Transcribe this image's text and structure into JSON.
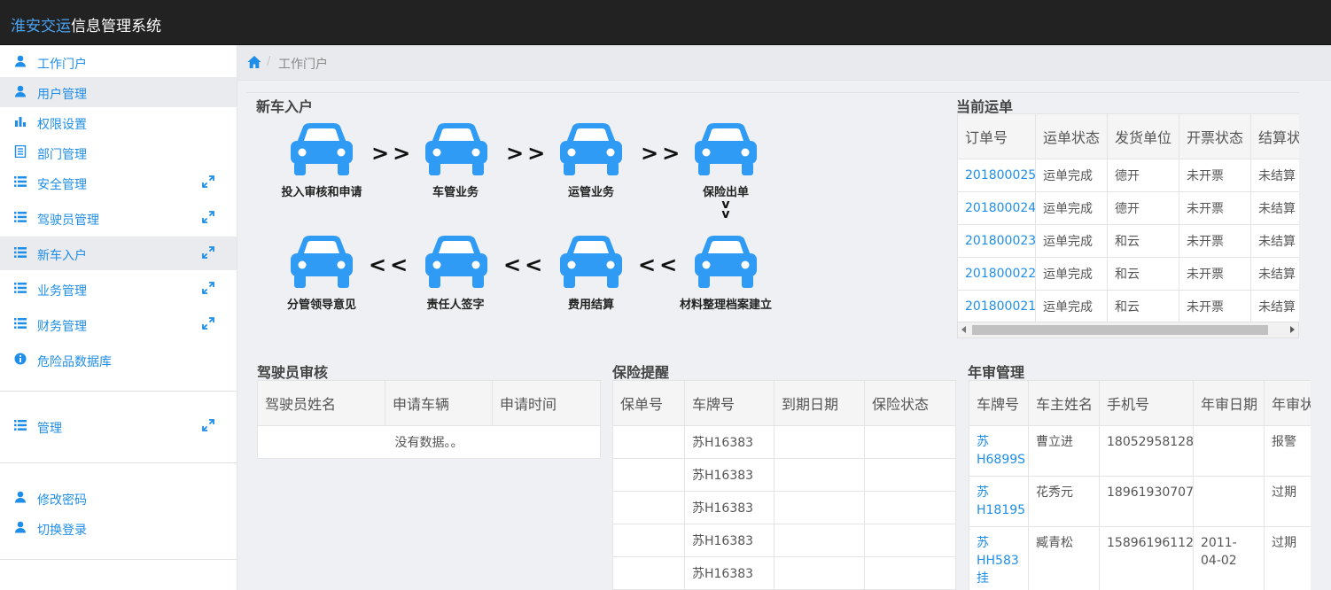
{
  "brand": {
    "highlight": "淮安交运",
    "rest": "信息管理系统"
  },
  "sidebar": {
    "items": [
      {
        "label": "工作门户",
        "icon": "user-icon"
      },
      {
        "label": "用户管理",
        "icon": "user-icon"
      },
      {
        "label": "权限设置",
        "icon": "bar-chart-icon"
      },
      {
        "label": "部门管理",
        "icon": "document-icon"
      },
      {
        "label": "安全管理",
        "icon": "list-icon",
        "expand_icon": "expand-icon"
      },
      {
        "label": "驾驶员管理",
        "icon": "list-icon",
        "expand_icon": "expand-icon"
      },
      {
        "label": "新车入户",
        "icon": "list-icon",
        "expand_icon": "expand-icon"
      },
      {
        "label": "业务管理",
        "icon": "list-icon",
        "expand_icon": "expand-icon"
      },
      {
        "label": "财务管理",
        "icon": "list-icon",
        "expand_icon": "expand-icon"
      },
      {
        "label": "危险品数据库",
        "icon": "info-icon"
      },
      {
        "label": "管理",
        "icon": "list-icon",
        "expand_icon": "expand-icon"
      },
      {
        "label": "修改密码",
        "icon": "user-icon"
      },
      {
        "label": "切换登录",
        "icon": "user-icon"
      }
    ]
  },
  "breadcrumb": {
    "home_icon": "home-icon",
    "separator": "/",
    "current": "工作门户"
  },
  "flow": {
    "title": "新车入户",
    "accent": "#2f9bf5",
    "steps": [
      "投入审核和申请",
      "车管业务",
      "运管业务",
      "保险出单",
      "材料整理档案建立",
      "费用结算",
      "责任人签字",
      "分管领导意见"
    ],
    "arrow_right": ">>",
    "arrow_left": "<<",
    "arrow_down": [
      "v",
      "v"
    ]
  },
  "orders": {
    "title": "当前运单",
    "columns": [
      "订单号",
      "运单状态",
      "发货单位",
      "开票状态",
      "结算状态"
    ],
    "rows": [
      [
        "201800025",
        "运单完成",
        "德开",
        "未开票",
        "未结算"
      ],
      [
        "201800024",
        "运单完成",
        "德开",
        "未开票",
        "未结算"
      ],
      [
        "201800023",
        "运单完成",
        "和云",
        "未开票",
        "未结算"
      ],
      [
        "201800022",
        "运单完成",
        "和云",
        "未开票",
        "未结算"
      ],
      [
        "201800021",
        "运单完成",
        "和云",
        "未开票",
        "未结算"
      ]
    ]
  },
  "driver_review": {
    "title": "驾驶员审核",
    "columns": [
      "驾驶员姓名",
      "申请车辆",
      "申请时间"
    ],
    "empty_text": "没有数据。。"
  },
  "insurance": {
    "title": "保险提醒",
    "columns": [
      "保单号",
      "车牌号",
      "到期日期",
      "保险状态"
    ],
    "rows": [
      [
        "",
        "苏H16383",
        "",
        ""
      ],
      [
        "",
        "苏H16383",
        "",
        ""
      ],
      [
        "",
        "苏H16383",
        "",
        ""
      ],
      [
        "",
        "苏H16383",
        "",
        ""
      ],
      [
        "",
        "苏H16383",
        "",
        ""
      ]
    ]
  },
  "annual": {
    "title": "年审管理",
    "columns": [
      "车牌号",
      "车主姓名",
      "手机号",
      "年审日期",
      "年审状态"
    ],
    "rows": [
      [
        "苏H6899S",
        "曹立进",
        "18052958128",
        "",
        "报警"
      ],
      [
        "苏H18195",
        "花秀元",
        "18961930707",
        "",
        "过期"
      ],
      [
        "苏HH583挂",
        "臧青松",
        "15896196112",
        "2011-04-02",
        "过期"
      ]
    ]
  }
}
